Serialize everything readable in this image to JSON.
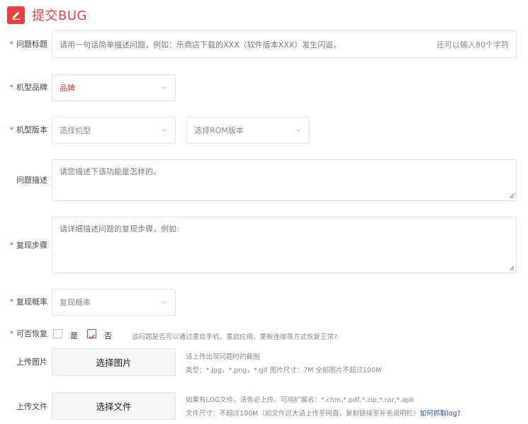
{
  "header": {
    "title": "提交BUG",
    "icon": "edit-pencil-icon",
    "accent": "#e8423f"
  },
  "form": {
    "required_mark": "*",
    "title_field": {
      "label": "问题标题",
      "placeholder": "请用一句话简单描述问题，例如：乐商店下载的XXX（软件版本XXX）发生闪退。",
      "counter": "还可以输入80个字符"
    },
    "brand": {
      "label": "机型品牌",
      "value": "品牌"
    },
    "version": {
      "label": "机型版本",
      "model_placeholder": "选择机型",
      "rom_placeholder": "选择ROM版本"
    },
    "description": {
      "label": "问题描述",
      "placeholder": "请您描述下该功能是怎样的。"
    },
    "steps": {
      "label": "复现步骤",
      "placeholder": "请详细描述问题的复现步骤，例如:"
    },
    "probability": {
      "label": "复现概率",
      "placeholder": "复现概率"
    },
    "recoverable": {
      "label": "可否恢复",
      "yes": "是",
      "no": "否",
      "yes_checked": false,
      "no_checked": true,
      "hint": "该问题是否可以通过重启手机、重启应用、重新连接等方式恢复正常?"
    },
    "upload_image": {
      "label": "上传图片",
      "button": "选择图片",
      "hint1": "请上传出现问题时的截图",
      "hint2": "类型：*.jpg，*.png，*.gif 图片尺寸：7M 全部图片不超过100M"
    },
    "upload_file": {
      "label": "上传文件",
      "button": "选择文件",
      "hint1": "如果有LOG文件，请务必上传。可用扩展名：*.chm,*.pdf,*.zip,*.rar,*.apk",
      "hint2": "文件尺寸：不超过100M（如文件过大请上传至网盘，复制链接至补充说明栏）",
      "link": "如何抓取log?"
    }
  }
}
